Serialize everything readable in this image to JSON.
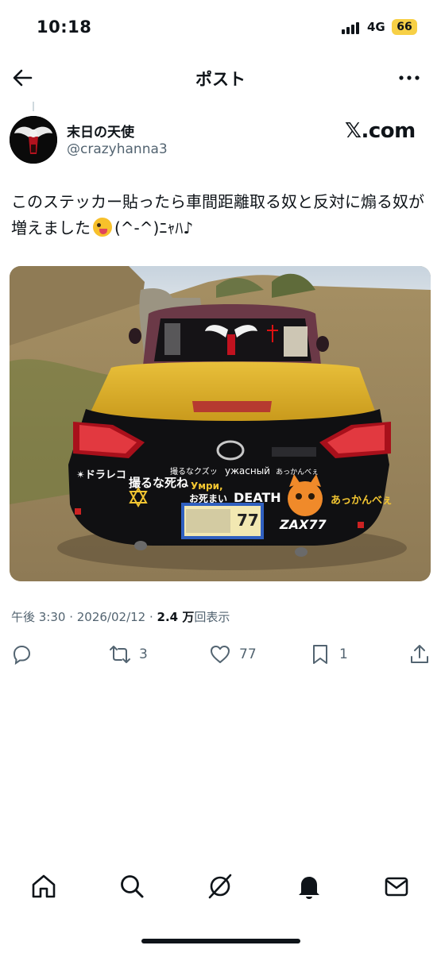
{
  "status_bar": {
    "time": "10:18",
    "network": "4G",
    "battery": "66"
  },
  "header": {
    "title": "ポスト",
    "back_icon": "arrow-left-icon",
    "more_icon": "more-dots-icon"
  },
  "author": {
    "display_name": "末日の天使",
    "handle": "@crazyhanna3",
    "site_label": "𝕏.com"
  },
  "tweet": {
    "text_before_emoji": "このステッカー貼ったら車間距離取る奴と反対に煽る奴が増えました",
    "text_after_emoji": "(^-^)ﾆｬﾊ♪",
    "emoji": "winking-face-with-tongue"
  },
  "photo": {
    "stickers": {
      "doraleco": "✴ドラレコ",
      "torunashine": "撮るな死ね",
      "umri": "Умри,",
      "omaemashi": "お死まい",
      "death": "DEATH",
      "akkanbee": "あっかんべぇ",
      "zax": "ZAX77",
      "top_strip_1": "撮るなクズッ",
      "top_strip_2": "ужасный",
      "top_strip_3": "あっかんべぇ",
      "plate": "77"
    }
  },
  "meta": {
    "timestamp": "午後 3:30 · 2026/02/12 · ",
    "views_count": "2.4 万",
    "views_label": "回表示"
  },
  "actions": {
    "reply_count": "",
    "repost_count": "3",
    "like_count": "77",
    "bookmark_count": "1"
  },
  "nav": {
    "items": [
      "home-icon",
      "search-icon",
      "grok-icon",
      "notifications-icon",
      "messages-icon"
    ]
  },
  "colors": {
    "text": "#0f1419",
    "secondary": "#536471",
    "battery": "#f7d046"
  }
}
